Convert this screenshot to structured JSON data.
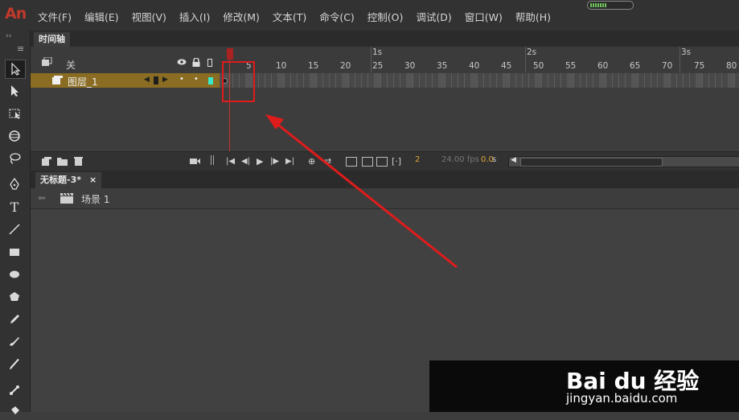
{
  "app": {
    "logo": "An"
  },
  "menu": [
    "文件(F)",
    "编辑(E)",
    "视图(V)",
    "插入(I)",
    "修改(M)",
    "文本(T)",
    "命令(C)",
    "控制(O)",
    "调试(D)",
    "窗口(W)",
    "帮助(H)"
  ],
  "toolbar": {
    "collapse": "‹‹",
    "grip": "≡",
    "tools": [
      "selection-tool",
      "subselection-tool",
      "free-transform-tool",
      "3d-rotation-tool",
      "lasso-tool",
      "pen-tool",
      "text-tool",
      "line-tool",
      "rectangle-tool",
      "oval-tool",
      "polystar-tool",
      "pencil-tool",
      "paint-brush-tool",
      "brush-tool",
      "bone-tool",
      "paint-bucket-tool"
    ]
  },
  "timeline": {
    "tab_label": "时间轴",
    "layers_header": "关",
    "layer_name": "图层_1",
    "ruler_numbers": [
      "5",
      "10",
      "15",
      "20",
      "25",
      "30",
      "35",
      "40",
      "45",
      "50",
      "55",
      "60",
      "65",
      "70",
      "75",
      "80"
    ],
    "ruler_seconds": [
      "1s",
      "2s",
      "3s"
    ],
    "current_frame": "2",
    "fps": "24.00 fps",
    "time": "0.0",
    "time_unit": "s",
    "layer_color": "#39e8c8",
    "layer_row_color": "#8a6d22"
  },
  "document": {
    "tab_label": "无标题-3*",
    "close_glyph": "×",
    "scene_label": "场景 1"
  },
  "watermark": {
    "brand": "Bai du 经验",
    "url": "jingyan.baidu.com"
  },
  "colors": {
    "accent_red": "#e01b1b",
    "frame_orange": "#e3a63a"
  }
}
